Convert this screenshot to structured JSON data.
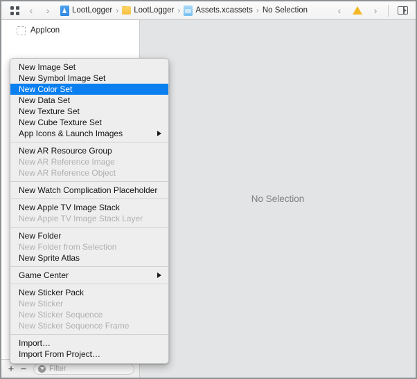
{
  "toolbar": {
    "grid_icon": "grid-squares-icon",
    "back_label": "‹",
    "forward_label": "›",
    "breadcrumb": [
      {
        "icon": "xcode-project-icon",
        "label": "LootLogger"
      },
      {
        "icon": "folder-icon",
        "label": "LootLogger"
      },
      {
        "icon": "asset-catalog-icon",
        "label": "Assets.xcassets"
      },
      {
        "icon": "",
        "label": "No Selection"
      }
    ],
    "separator": "›",
    "issue_prev_label": "‹",
    "issue_next_label": "›",
    "warning_icon": "warning-triangle-icon",
    "panel_toggle_icon": "inspector-panel-toggle-icon"
  },
  "sidebar": {
    "assets": [
      {
        "icon": "app-icon-placeholder-icon",
        "label": "AppIcon"
      }
    ],
    "footer": {
      "add_label": "+",
      "remove_label": "−",
      "filter_icon": "filter-funnel-icon",
      "filter_value": "",
      "filter_placeholder": "Filter"
    }
  },
  "detail": {
    "no_selection_text": "No Selection"
  },
  "context_menu": {
    "groups": [
      {
        "items": [
          {
            "label": "New Image Set",
            "state": "enabled",
            "submenu": false
          },
          {
            "label": "New Symbol Image Set",
            "state": "enabled",
            "submenu": false
          },
          {
            "label": "New Color Set",
            "state": "selected",
            "submenu": false
          },
          {
            "label": "New Data Set",
            "state": "enabled",
            "submenu": false
          },
          {
            "label": "New Texture Set",
            "state": "enabled",
            "submenu": false
          },
          {
            "label": "New Cube Texture Set",
            "state": "enabled",
            "submenu": false
          },
          {
            "label": "App Icons & Launch Images",
            "state": "enabled",
            "submenu": true
          }
        ]
      },
      {
        "items": [
          {
            "label": "New AR Resource Group",
            "state": "enabled",
            "submenu": false
          },
          {
            "label": "New AR Reference Image",
            "state": "disabled",
            "submenu": false
          },
          {
            "label": "New AR Reference Object",
            "state": "disabled",
            "submenu": false
          }
        ]
      },
      {
        "items": [
          {
            "label": "New Watch Complication Placeholder",
            "state": "enabled",
            "submenu": false
          }
        ]
      },
      {
        "items": [
          {
            "label": "New Apple TV Image Stack",
            "state": "enabled",
            "submenu": false
          },
          {
            "label": "New Apple TV Image Stack Layer",
            "state": "disabled",
            "submenu": false
          }
        ]
      },
      {
        "items": [
          {
            "label": "New Folder",
            "state": "enabled",
            "submenu": false
          },
          {
            "label": "New Folder from Selection",
            "state": "disabled",
            "submenu": false
          },
          {
            "label": "New Sprite Atlas",
            "state": "enabled",
            "submenu": false
          }
        ]
      },
      {
        "items": [
          {
            "label": "Game Center",
            "state": "enabled",
            "submenu": true
          }
        ]
      },
      {
        "items": [
          {
            "label": "New Sticker Pack",
            "state": "enabled",
            "submenu": false
          },
          {
            "label": "New Sticker",
            "state": "disabled",
            "submenu": false
          },
          {
            "label": "New Sticker Sequence",
            "state": "disabled",
            "submenu": false
          },
          {
            "label": "New Sticker Sequence Frame",
            "state": "disabled",
            "submenu": false
          }
        ]
      },
      {
        "items": [
          {
            "label": "Import…",
            "state": "enabled",
            "submenu": false
          },
          {
            "label": "Import From Project…",
            "state": "enabled",
            "submenu": false
          }
        ]
      }
    ]
  },
  "colors": {
    "selection_blue": "#0a7ff0",
    "menu_background": "#eeeeee",
    "detail_background": "#e2e4e6",
    "warning_yellow": "#f2b823",
    "folder_yellow": "#f4bf3e",
    "project_blue": "#2e86e0"
  }
}
